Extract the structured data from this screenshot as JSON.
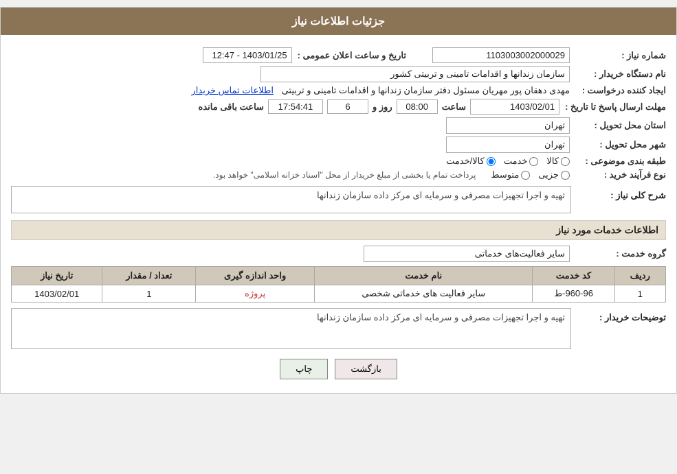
{
  "header": {
    "title": "جزئیات اطلاعات نیاز"
  },
  "fields": {
    "need_number_label": "شماره نیاز :",
    "need_number_value": "1103003002000029",
    "announcement_datetime_label": "تاریخ و ساعت اعلان عمومی :",
    "announcement_datetime_value": "1403/01/25 - 12:47",
    "buyer_org_label": "نام دستگاه خریدار :",
    "buyer_org_value": "سازمان زندانها و اقدامات تامینی و تربیتی کشور",
    "creator_label": "ایجاد کننده درخواست :",
    "creator_value": "مهدی  دهقان پور مهریان مسئول دفتر سازمان زندانها و اقدامات تامینی و تربیتی",
    "creator_link": "اطلاعات تماس خریدار",
    "deadline_label": "مهلت ارسال پاسخ تا تاریخ :",
    "deadline_date": "1403/02/01",
    "deadline_time_label": "ساعت",
    "deadline_time": "08:00",
    "deadline_days_label": "روز و",
    "deadline_days": "6",
    "deadline_remaining_label": "ساعت باقی مانده",
    "deadline_remaining": "17:54:41",
    "province_label": "استان محل تحویل :",
    "province_value": "تهران",
    "city_label": "شهر محل تحویل :",
    "city_value": "تهران",
    "category_label": "طبقه بندی موضوعی :",
    "category_options": [
      {
        "label": "کالا",
        "checked": false
      },
      {
        "label": "خدمت",
        "checked": false
      },
      {
        "label": "کالا/خدمت",
        "checked": true
      }
    ],
    "purchase_type_label": "نوع فرآیند خرید :",
    "purchase_type_options": [
      {
        "label": "جزیی",
        "checked": false
      },
      {
        "label": "متوسط",
        "checked": false
      }
    ],
    "purchase_type_notice": "پرداخت تمام یا بخشی از مبلغ خریدار از محل \"اسناد خزانه اسلامی\" خواهد بود.",
    "general_desc_label": "شرح کلی نیاز :",
    "general_desc_value": "تهیه و اجرا تجهیزات مصرفی و سرمایه ای مرکز داده سازمان زندانها",
    "services_section_title": "اطلاعات خدمات مورد نیاز",
    "service_group_label": "گروه خدمت :",
    "service_group_value": "سایر فعالیت‌های خدماتی",
    "table": {
      "headers": [
        "ردیف",
        "کد خدمت",
        "نام خدمت",
        "واحد اندازه گیری",
        "تعداد / مقدار",
        "تاریخ نیاز"
      ],
      "rows": [
        {
          "row_num": "1",
          "code": "960-96-ط",
          "name": "سایر فعالیت های خدماتی شخصی",
          "unit": "پروژه",
          "quantity": "1",
          "date": "1403/02/01"
        }
      ]
    },
    "buyer_desc_label": "توضیحات خریدار :",
    "buyer_desc_value": "تهیه و اجرا تجهیزات مصرفی و سرمایه ای مرکز داده سازمان زندانها"
  },
  "buttons": {
    "print_label": "چاپ",
    "back_label": "بازگشت"
  }
}
